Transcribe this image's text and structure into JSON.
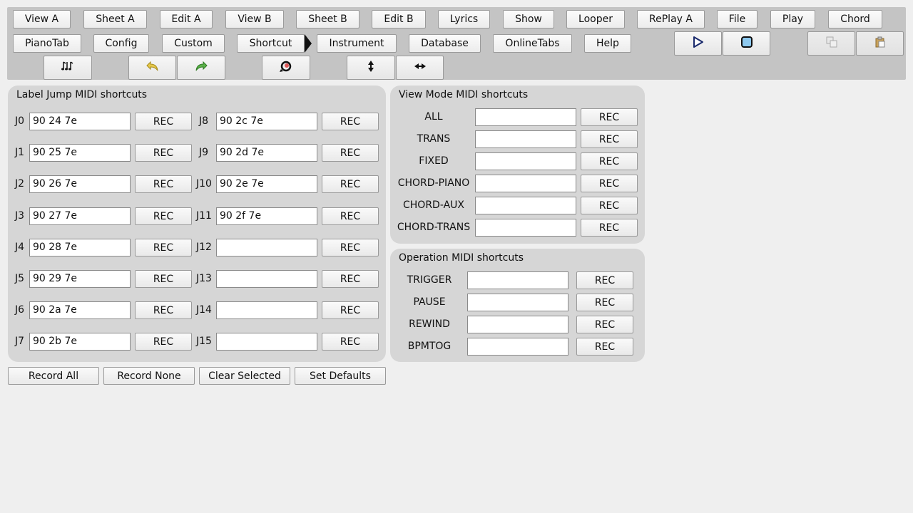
{
  "toolbar": {
    "row1": [
      "View A",
      "Sheet A",
      "Edit A",
      "View B",
      "Sheet B",
      "Edit B",
      "Lyrics",
      "Show",
      "Looper",
      "RePlay A",
      "File",
      "Play",
      "Chord"
    ],
    "row2": [
      "PianoTab",
      "Config",
      "Custom",
      "Shortcut",
      "Instrument",
      "Database",
      "OnlineTabs",
      "Help"
    ],
    "active_tab": "Shortcut",
    "icons": {
      "play": "play-icon",
      "stop": "stop-icon",
      "copy": "copy-icon",
      "paste": "paste-icon",
      "notes": "music-notes-icon",
      "undo": "undo-icon",
      "redo": "redo-icon",
      "reload": "reload-icon",
      "vertical": "vertical-arrows-icon",
      "horizontal": "horizontal-arrows-icon"
    },
    "colors": {
      "play": "#1a2a6c",
      "stop_fill": "#8ec9ef",
      "undo": "#e6c84a",
      "redo": "#5bb04a",
      "reload": "#e05a5a"
    }
  },
  "label_jump": {
    "title": "Label Jump MIDI shortcuts",
    "rec_label": "REC",
    "left": [
      {
        "label": "J0",
        "value": "90 24 7e"
      },
      {
        "label": "J1",
        "value": "90 25 7e"
      },
      {
        "label": "J2",
        "value": "90 26 7e"
      },
      {
        "label": "J3",
        "value": "90 27 7e"
      },
      {
        "label": "J4",
        "value": "90 28 7e"
      },
      {
        "label": "J5",
        "value": "90 29 7e"
      },
      {
        "label": "J6",
        "value": "90 2a 7e"
      },
      {
        "label": "J7",
        "value": "90 2b 7e"
      }
    ],
    "right": [
      {
        "label": "J8",
        "value": "90 2c 7e"
      },
      {
        "label": "J9",
        "value": "90 2d 7e"
      },
      {
        "label": "J10",
        "value": "90 2e 7e"
      },
      {
        "label": "J11",
        "value": "90 2f 7e"
      },
      {
        "label": "J12",
        "value": ""
      },
      {
        "label": "J13",
        "value": ""
      },
      {
        "label": "J14",
        "value": ""
      },
      {
        "label": "J15",
        "value": ""
      }
    ]
  },
  "view_mode": {
    "title": "View Mode MIDI shortcuts",
    "rec_label": "REC",
    "items": [
      {
        "label": "ALL",
        "value": ""
      },
      {
        "label": "TRANS",
        "value": ""
      },
      {
        "label": "FIXED",
        "value": ""
      },
      {
        "label": "CHORD-PIANO",
        "value": ""
      },
      {
        "label": "CHORD-AUX",
        "value": ""
      },
      {
        "label": "CHORD-TRANS",
        "value": ""
      }
    ]
  },
  "operation": {
    "title": "Operation MIDI shortcuts",
    "rec_label": "REC",
    "items": [
      {
        "label": "TRIGGER",
        "value": ""
      },
      {
        "label": "PAUSE",
        "value": ""
      },
      {
        "label": "REWIND",
        "value": ""
      },
      {
        "label": "BPMTOG",
        "value": ""
      }
    ]
  },
  "bottom": {
    "record_all": "Record All",
    "record_none": "Record None",
    "clear_selected": "Clear Selected",
    "set_defaults": "Set Defaults"
  }
}
